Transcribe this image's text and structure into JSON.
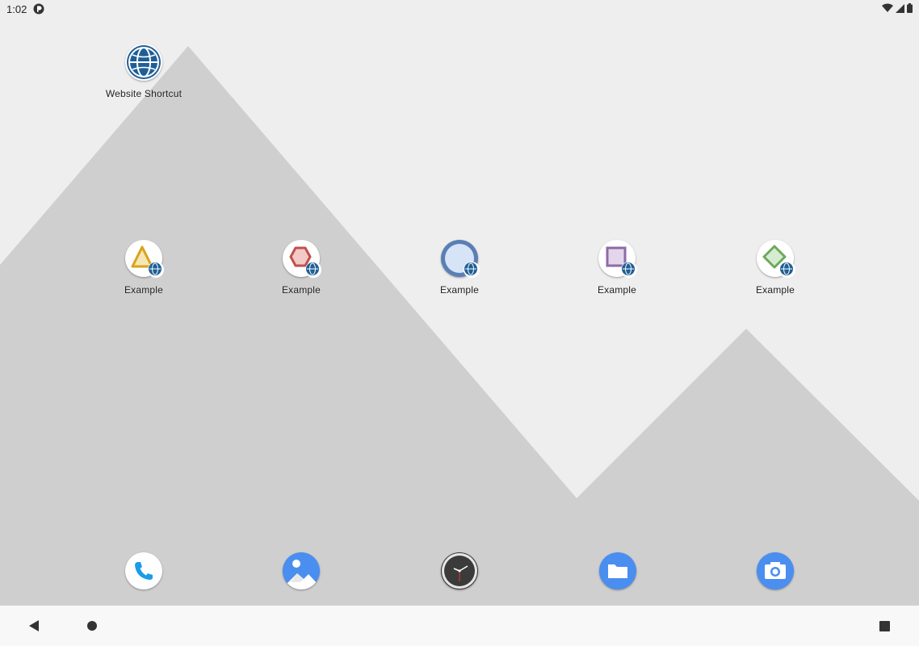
{
  "status_bar": {
    "time": "1:02",
    "notification_icon": "sync-app-icon",
    "wifi_icon": "wifi-icon",
    "signal_icon": "cell-signal-icon",
    "battery_icon": "battery-icon"
  },
  "desktop": {
    "shortcut": {
      "label": "Website Shortcut",
      "icon": "globe-icon"
    },
    "apps": [
      {
        "label": "Example",
        "icon": "triangle-icon",
        "color": "#d9a21b"
      },
      {
        "label": "Example",
        "icon": "hexagon-icon",
        "color": "#c0504d"
      },
      {
        "label": "Example",
        "icon": "circle-icon",
        "color": "#5a7fb5"
      },
      {
        "label": "Example",
        "icon": "square-icon",
        "color": "#8e6aa6"
      },
      {
        "label": "Example",
        "icon": "diamond-icon",
        "color": "#6ea85a"
      }
    ]
  },
  "dock": [
    {
      "icon": "phone-icon",
      "color": "#1a9de8"
    },
    {
      "icon": "gallery-icon",
      "color": "#4a8ef0"
    },
    {
      "icon": "clock-icon",
      "color": "#3a3a3a"
    },
    {
      "icon": "files-icon",
      "color": "#4a8ef0"
    },
    {
      "icon": "camera-icon",
      "color": "#4a8ef0"
    }
  ],
  "nav_bar": {
    "back": "back-icon",
    "home": "home-icon",
    "recents": "recents-icon"
  }
}
